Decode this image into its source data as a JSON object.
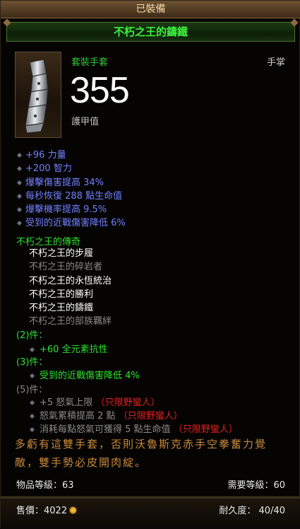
{
  "header": {
    "equipped": "已裝備"
  },
  "item": {
    "name": "不朽之王的鑄鐵",
    "type": "套裝手套",
    "slot": "手掌",
    "armor_value": "355",
    "armor_label": "護甲值",
    "icon": "gauntlet-icon"
  },
  "affixes": [
    "+96 力量",
    "+200 智力",
    "爆擊傷害提高 34%",
    "每秒恢復 288 點生命值",
    "爆擊機率提高 9.5%",
    "受到的近戰傷害降低 6%"
  ],
  "set": {
    "name": "不朽之王的傳奇",
    "items": [
      {
        "label": "不朽之王的步履"
      },
      {
        "label": "不朽之王的碎岩者"
      },
      {
        "label": "不朽之王的永恆統治"
      },
      {
        "label": "不朽之王的勝利"
      },
      {
        "label": "不朽之王的鑄鐵"
      },
      {
        "label": "不朽之王的部族羈絆"
      }
    ],
    "bonus2_label": "(2)件：",
    "bonus2_line": "+60 全元素抗性",
    "bonus3_label": "(3)件：",
    "bonus3_line": "受到的近戰傷害降低 4%",
    "bonus5_label": "(5)件：",
    "bonus5_lines": [
      {
        "text": "+5 怒氣上限",
        "restriction": "（只限野蠻人）"
      },
      {
        "text": "怒氣累積提高 2 點",
        "restriction": "（只限野蠻人）"
      },
      {
        "text": "消耗每點怒氣可獲得 5 點生命值",
        "restriction": "（只限野蠻人）"
      }
    ]
  },
  "flavor": "多虧有這雙手套，否則沃魯斯克赤手空拳奮力覺敵，雙手勢必皮開肉綻。",
  "footer": {
    "item_level": "物品等級：63",
    "required_level": "需要等級：60",
    "sell_label": "售價：",
    "sell_value": "4022",
    "durability_label": "耐久度：",
    "durability_value": "40/40"
  },
  "colors": {
    "magic_affix": "#7080ff",
    "set_green": "#2ee02e",
    "inactive_gray": "#8a8a8a",
    "restriction_red": "#e02020",
    "flavor_orange": "#c8893a"
  }
}
